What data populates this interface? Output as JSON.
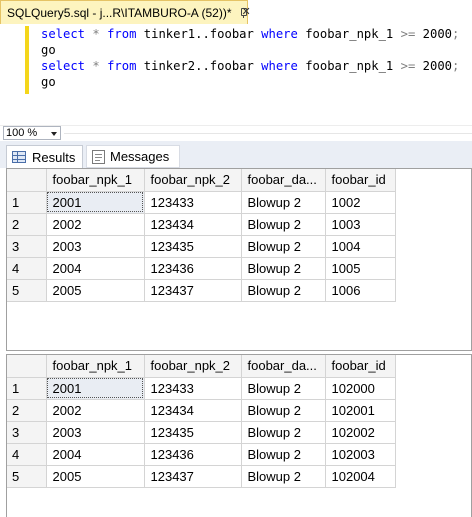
{
  "document_tab": {
    "title": "SQLQuery5.sql - j...R\\ITAMBURO-A (52))*"
  },
  "editor": {
    "lines": [
      {
        "kw1": "select",
        "op": "*",
        "kw2": "from",
        "table": "tinker1..foobar",
        "kw3": "where",
        "col": "foobar_npk_1",
        "cmp": ">=",
        "val": "2000",
        "end": ";"
      },
      {
        "go": "go"
      },
      {
        "kw1": "select",
        "op": "*",
        "kw2": "from",
        "table": "tinker2..foobar",
        "kw3": "where",
        "col": "foobar_npk_1",
        "cmp": ">=",
        "val": "2000",
        "end": ";"
      },
      {
        "go": "go"
      }
    ]
  },
  "zoom": {
    "value": "100 %"
  },
  "results_tabs": {
    "results": "Results",
    "messages": "Messages"
  },
  "grid1": {
    "headers": [
      "foobar_npk_1",
      "foobar_npk_2",
      "foobar_da...",
      "foobar_id"
    ],
    "rows": [
      {
        "num": "1",
        "cells": [
          "2001",
          "123433",
          "Blowup 2",
          "1002"
        ]
      },
      {
        "num": "2",
        "cells": [
          "2002",
          "123434",
          "Blowup 2",
          "1003"
        ]
      },
      {
        "num": "3",
        "cells": [
          "2003",
          "123435",
          "Blowup 2",
          "1004"
        ]
      },
      {
        "num": "4",
        "cells": [
          "2004",
          "123436",
          "Blowup 2",
          "1005"
        ]
      },
      {
        "num": "5",
        "cells": [
          "2005",
          "123437",
          "Blowup 2",
          "1006"
        ]
      }
    ]
  },
  "grid2": {
    "headers": [
      "foobar_npk_1",
      "foobar_npk_2",
      "foobar_da...",
      "foobar_id"
    ],
    "rows": [
      {
        "num": "1",
        "cells": [
          "2001",
          "123433",
          "Blowup 2",
          "102000"
        ]
      },
      {
        "num": "2",
        "cells": [
          "2002",
          "123434",
          "Blowup 2",
          "102001"
        ]
      },
      {
        "num": "3",
        "cells": [
          "2003",
          "123435",
          "Blowup 2",
          "102002"
        ]
      },
      {
        "num": "4",
        "cells": [
          "2004",
          "123436",
          "Blowup 2",
          "102003"
        ]
      },
      {
        "num": "5",
        "cells": [
          "2005",
          "123437",
          "Blowup 2",
          "102004"
        ]
      }
    ]
  },
  "colors": {
    "tab_active": "#fdf4bf",
    "keyword": "#0000ff",
    "change_bar": "#f4d61b"
  }
}
